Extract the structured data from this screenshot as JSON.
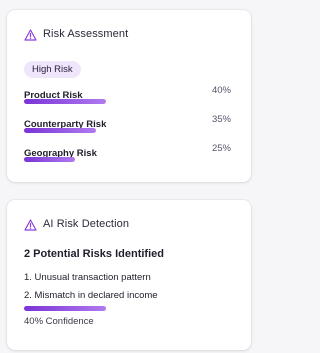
{
  "risk_assessment": {
    "title": "Risk Assessment",
    "badge": "High Risk",
    "metrics": [
      {
        "label": "Product Risk",
        "value": "40%",
        "level": 40
      },
      {
        "label": "Counterparty Risk",
        "value": "35%",
        "level": 35
      },
      {
        "label": "Geography Risk",
        "value": "25%",
        "level": 25
      }
    ]
  },
  "ai_detection": {
    "title": "AI Risk Detection",
    "heading": "2 Potential Risks Identified",
    "items": [
      "1. Unusual transaction pattern",
      "2. Mismatch in declared income"
    ],
    "confidence_level": 40,
    "confidence_text": "40% Confidence"
  },
  "colors": {
    "accent": "#7a33d6",
    "badge_bg": "#efe6fb"
  },
  "icons": {
    "header_icon": "warning-triangle-icon"
  }
}
